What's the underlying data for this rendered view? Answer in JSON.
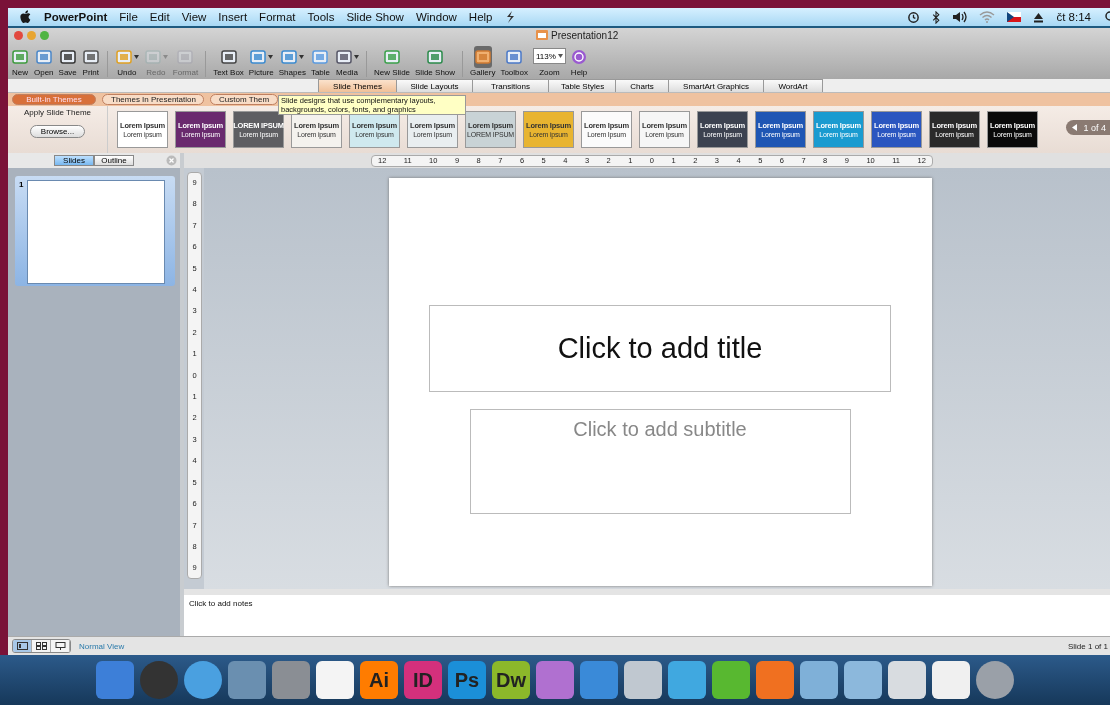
{
  "menubar": {
    "app": "PowerPoint",
    "items": [
      "File",
      "Edit",
      "View",
      "Insert",
      "Format",
      "Tools",
      "Slide Show",
      "Window",
      "Help"
    ],
    "clock": "čt 8:14"
  },
  "window": {
    "title": "Presentation12"
  },
  "toolbar": [
    {
      "label": "New",
      "disabled": false,
      "pressed": false,
      "menu": false
    },
    {
      "label": "Open",
      "disabled": false,
      "pressed": false,
      "menu": false
    },
    {
      "label": "Save",
      "disabled": false,
      "pressed": false,
      "menu": false
    },
    {
      "label": "Print",
      "disabled": false,
      "pressed": false,
      "menu": false
    },
    {
      "label": "Undo",
      "disabled": false,
      "pressed": false,
      "menu": true
    },
    {
      "label": "Redo",
      "disabled": true,
      "pressed": false,
      "menu": true
    },
    {
      "label": "Format",
      "disabled": true,
      "pressed": false,
      "menu": false
    },
    {
      "label": "Text Box",
      "disabled": false,
      "pressed": false,
      "menu": false
    },
    {
      "label": "Picture",
      "disabled": false,
      "pressed": false,
      "menu": true
    },
    {
      "label": "Shapes",
      "disabled": false,
      "pressed": false,
      "menu": true
    },
    {
      "label": "Table",
      "disabled": false,
      "pressed": false,
      "menu": false
    },
    {
      "label": "Media",
      "disabled": false,
      "pressed": false,
      "menu": true
    },
    {
      "label": "New Slide",
      "disabled": false,
      "pressed": false,
      "menu": false
    },
    {
      "label": "Slide Show",
      "disabled": false,
      "pressed": false,
      "menu": false
    },
    {
      "label": "Gallery",
      "disabled": false,
      "pressed": true,
      "menu": false
    },
    {
      "label": "Toolbox",
      "disabled": false,
      "pressed": false,
      "menu": false
    }
  ],
  "zoom": {
    "value": "113%",
    "label": "Zoom"
  },
  "help": {
    "label": "Help"
  },
  "ribbon_tabs": [
    {
      "label": "Slide Themes",
      "selected": true
    },
    {
      "label": "Slide Layouts",
      "selected": false
    },
    {
      "label": "Transitions",
      "selected": false
    },
    {
      "label": "Table Styles",
      "selected": false
    },
    {
      "label": "Charts",
      "selected": false
    },
    {
      "label": "SmartArt Graphics",
      "selected": false
    },
    {
      "label": "WordArt",
      "selected": false
    }
  ],
  "theme_tabs": [
    {
      "label": "Built-in Themes",
      "selected": true
    },
    {
      "label": "Themes In Presentation",
      "selected": false
    },
    {
      "label": "Custom Them",
      "selected": false
    }
  ],
  "tooltip": "Slide designs that use complementary layouts, backgrounds, colors, fonts, and graphics",
  "apply_theme": {
    "heading": "Apply Slide Theme",
    "button": "Browse..."
  },
  "themes": [
    {
      "title": "Lorem Ipsum",
      "subtitle": "Lorem ipsum",
      "color": "#ffffff"
    },
    {
      "title": "Lorem Ipsum",
      "subtitle": "Lorem Ipsum",
      "color": "#6a2a6e"
    },
    {
      "title": "LOREM IPSUM",
      "subtitle": "Lorem Ipsum",
      "color": "#5e5e62"
    },
    {
      "title": "Lorem Ipsum",
      "subtitle": "Lorem ipsum",
      "color": "#f4f2ee"
    },
    {
      "title": "Lorem Ipsum",
      "subtitle": "Lorem ipsum",
      "color": "#cfe9ef"
    },
    {
      "title": "Lorem Ipsum",
      "subtitle": "Lorem Ipsum",
      "color": "#e9eef0"
    },
    {
      "title": "Lorem Ipsum",
      "subtitle": "LOREM IPSUM",
      "color": "#c9d3d6"
    },
    {
      "title": "Lorem Ipsum",
      "subtitle": "Lorem ipsum",
      "color": "#e8b430"
    },
    {
      "title": "Lorem Ipsum",
      "subtitle": "Lorem Ipsum",
      "color": "#fbfbfb"
    },
    {
      "title": "Lorem Ipsum",
      "subtitle": "Lorem ipsum",
      "color": "#f6f6f6"
    },
    {
      "title": "Lorem Ipsum",
      "subtitle": "Lorem Ipsum",
      "color": "#3c4250"
    },
    {
      "title": "Lorem Ipsum",
      "subtitle": "Lorem ipsum",
      "color": "#1f56b4"
    },
    {
      "title": "Lorem Ipsum",
      "subtitle": "Lorem ipsum",
      "color": "#1a9bd0"
    },
    {
      "title": "Lorem Ipsum",
      "subtitle": "Lorem ipsum",
      "color": "#2a56c0"
    },
    {
      "title": "Lorem Ipsum",
      "subtitle": "Lorem ipsum",
      "color": "#2a2a2a"
    },
    {
      "title": "Lorem Ipsum",
      "subtitle": "Lorem ipsum",
      "color": "#0a0a0a"
    }
  ],
  "gallery_pager": "1 of 4",
  "view_tabs": [
    {
      "label": "Slides",
      "selected": true
    },
    {
      "label": "Outline",
      "selected": false
    }
  ],
  "slides": [
    {
      "number": "1",
      "selected": true
    }
  ],
  "ruler_h": [
    "12",
    "11",
    "10",
    "9",
    "8",
    "7",
    "6",
    "5",
    "4",
    "3",
    "2",
    "1",
    "0",
    "1",
    "2",
    "3",
    "4",
    "5",
    "6",
    "7",
    "8",
    "9",
    "10",
    "11",
    "12"
  ],
  "ruler_v": [
    "9",
    "8",
    "7",
    "6",
    "5",
    "4",
    "3",
    "2",
    "1",
    "0",
    "1",
    "2",
    "3",
    "4",
    "5",
    "6",
    "7",
    "8",
    "9"
  ],
  "slide": {
    "title": "Click to add title",
    "subtitle": "Click to add subtitle"
  },
  "notes": {
    "placeholder": "Click to add notes"
  },
  "status": {
    "views": [
      {
        "selected": true
      },
      {
        "selected": false
      },
      {
        "selected": false
      }
    ],
    "view_name": "Normal View",
    "slide_count": "Slide 1 of 1"
  },
  "dock": [
    {
      "color": "#3d7fd8"
    },
    {
      "color": "#333333"
    },
    {
      "color": "#4aa0e0"
    },
    {
      "color": "#6a8fb0"
    },
    {
      "color": "#8a8e94"
    },
    {
      "color": "#f4f4f4"
    },
    {
      "label": "Ai",
      "color": "#ff7c00"
    },
    {
      "label": "ID",
      "color": "#d4307c"
    },
    {
      "label": "Ps",
      "color": "#1b8fd8"
    },
    {
      "label": "Dw",
      "color": "#8cb82a"
    },
    {
      "color": "#b070d0"
    },
    {
      "color": "#3a8ad8"
    },
    {
      "color": "#c0c8d0"
    },
    {
      "color": "#40a8e0"
    },
    {
      "color": "#58b830"
    },
    {
      "color": "#f07020"
    },
    {
      "color": "#7fb0d8"
    },
    {
      "color": "#8cb8dc"
    },
    {
      "color": "#d8dce0"
    },
    {
      "color": "#f0f0f0"
    },
    {
      "color": "#9aa0a8"
    }
  ]
}
